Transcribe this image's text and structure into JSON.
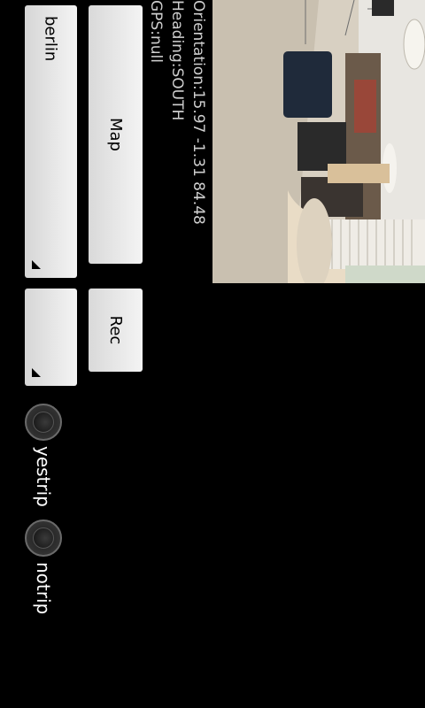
{
  "buttons": {
    "map_label": "Map",
    "rec_label": "Rec"
  },
  "spinners": {
    "city_value": "berlin",
    "second_value": ""
  },
  "sensors": {
    "orientation": "Orientation:15.97 -1.31 84.48",
    "heading": "Heading:SOUTH",
    "gps": "GPS:null"
  },
  "trip_options": [
    {
      "label": "yestrip"
    },
    {
      "label": "notrip"
    }
  ],
  "colors": {
    "background": "#000000",
    "button": "#e6e6e6",
    "info_text": "#cfcfcf",
    "radio_label": "#ffffff"
  }
}
